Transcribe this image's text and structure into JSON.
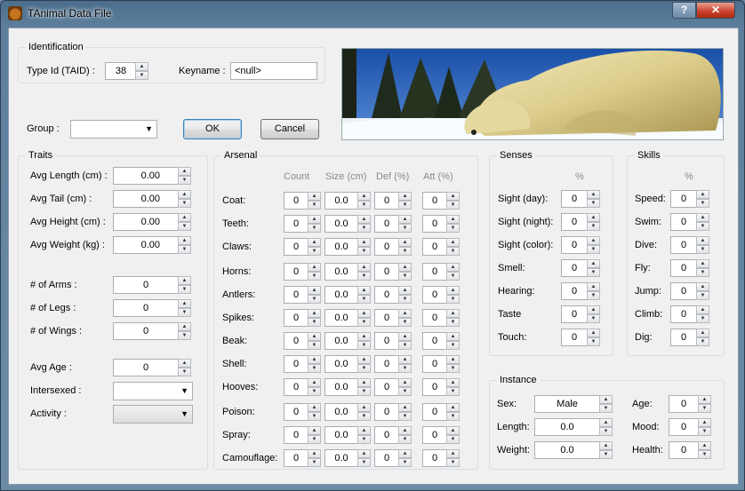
{
  "window": {
    "title": "TAnimal Data File",
    "help_glyph": "?",
    "close_glyph": "✕"
  },
  "identification": {
    "title": "Identification",
    "type_id_label": "Type Id (TAID) :",
    "type_id_value": "38",
    "keyname_label": "Keyname :",
    "keyname_value": "<null>"
  },
  "group": {
    "label": "Group :",
    "value": ""
  },
  "buttons": {
    "ok": "OK",
    "cancel": "Cancel"
  },
  "traits": {
    "title": "Traits",
    "fields": [
      {
        "label": "Avg Length (cm)  :",
        "value": "0.00"
      },
      {
        "label": "Avg Tail (cm)       :",
        "value": "0.00"
      },
      {
        "label": "Avg Height (cm)  :",
        "value": "0.00"
      },
      {
        "label": "Avg Weight (kg)   :",
        "value": "0.00"
      },
      {
        "label": "# of Arms   :",
        "value": "0"
      },
      {
        "label": "# of Legs    :",
        "value": "0"
      },
      {
        "label": "# of Wings  :",
        "value": "0"
      },
      {
        "label": "Avg Age       :",
        "value": "0"
      }
    ],
    "intersexed_label": "Intersexed :",
    "intersexed_value": "",
    "activity_label": "Activity      :",
    "activity_value": ""
  },
  "arsenal": {
    "title": "Arsenal",
    "columns": [
      "Count",
      "Size (cm)",
      "Def (%)",
      "Att (%)"
    ],
    "rows": [
      {
        "label": "Coat:",
        "values": [
          "0",
          "0.0",
          "0",
          "0"
        ]
      },
      {
        "label": "Teeth:",
        "values": [
          "0",
          "0.0",
          "0",
          "0"
        ]
      },
      {
        "label": "Claws:",
        "values": [
          "0",
          "0.0",
          "0",
          "0"
        ]
      },
      {
        "label": "Horns:",
        "values": [
          "0",
          "0.0",
          "0",
          "0"
        ]
      },
      {
        "label": "Antlers:",
        "values": [
          "0",
          "0.0",
          "0",
          "0"
        ]
      },
      {
        "label": "Spikes:",
        "values": [
          "0",
          "0.0",
          "0",
          "0"
        ]
      },
      {
        "label": "Beak:",
        "values": [
          "0",
          "0.0",
          "0",
          "0"
        ]
      },
      {
        "label": "Shell:",
        "values": [
          "0",
          "0.0",
          "0",
          "0"
        ]
      },
      {
        "label": "Hooves:",
        "values": [
          "0",
          "0.0",
          "0",
          "0"
        ]
      },
      {
        "label": "Poison:",
        "values": [
          "0",
          "0.0",
          "0",
          "0"
        ]
      },
      {
        "label": "Spray:",
        "values": [
          "0",
          "0.0",
          "0",
          "0"
        ]
      },
      {
        "label": "Camouflage:",
        "values": [
          "0",
          "0.0",
          "0",
          "0"
        ]
      }
    ]
  },
  "senses": {
    "title": "Senses",
    "column": "%",
    "rows": [
      {
        "label": "Sight (day):",
        "value": "0"
      },
      {
        "label": "Sight (night):",
        "value": "0"
      },
      {
        "label": "Sight (color):",
        "value": "0"
      },
      {
        "label": "Smell:",
        "value": "0"
      },
      {
        "label": "Hearing:",
        "value": "0"
      },
      {
        "label": "Taste",
        "value": "0"
      },
      {
        "label": "Touch:",
        "value": "0"
      }
    ]
  },
  "skills": {
    "title": "Skills",
    "column": "%",
    "rows": [
      {
        "label": "Speed:",
        "value": "0"
      },
      {
        "label": "Swim:",
        "value": "0"
      },
      {
        "label": "Dive:",
        "value": "0"
      },
      {
        "label": "Fly:",
        "value": "0"
      },
      {
        "label": "Jump:",
        "value": "0"
      },
      {
        "label": "Climb:",
        "value": "0"
      },
      {
        "label": "Dig:",
        "value": "0"
      }
    ]
  },
  "instance": {
    "title": "Instance",
    "sex_label": "Sex:",
    "sex_value": "Male",
    "length_label": "Length:",
    "length_value": "0.0",
    "weight_label": "Weight:",
    "weight_value": "0.0",
    "age_label": "Age:",
    "age_value": "0",
    "mood_label": "Mood:",
    "mood_value": "0",
    "health_label": "Health:",
    "health_value": "0"
  },
  "colors": {
    "accent": "#3c7fb1",
    "window_frame": "#5d7f9c",
    "client_bg": "#f0f0f0"
  },
  "image": {
    "subject": "polar-bear-photo"
  }
}
